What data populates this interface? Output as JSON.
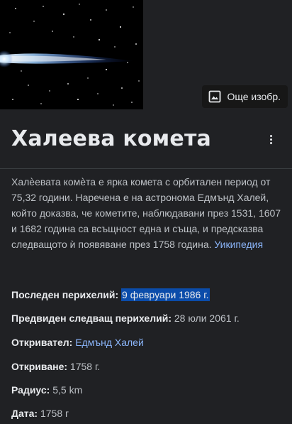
{
  "hero": {
    "more_images_label": "Още изобр."
  },
  "title": "Халеева комета",
  "description": {
    "text": "Халѐевата комѐта е ярка комета с орбитален период от 75,32 години. Наречена е на астронома Едмънд Халей, който доказва, че кометите, наблюдавани през 1531, 1607 и 1682 година са всъщност една и съща, и предсказва следващото ѝ появяване през 1758 година.",
    "source_link": "Уикипедия"
  },
  "facts": [
    {
      "label": "Последен перихелий:",
      "value": "9 февруари 1986 г.",
      "style": "highlight"
    },
    {
      "label": "Предвиден следващ перихелий:",
      "value": "28 юли 2061 г.",
      "style": "plain"
    },
    {
      "label": "Откривател:",
      "value": "Едмънд Халей",
      "style": "link"
    },
    {
      "label": "Откриване:",
      "value": "1758 г.",
      "style": "plain"
    },
    {
      "label": "Радиус:",
      "value": "5,5 km",
      "style": "plain"
    },
    {
      "label": "Дата:",
      "value": "1758 г",
      "style": "plain"
    }
  ],
  "colors": {
    "background": "#202124",
    "text": "#e8eaed",
    "secondary_text": "#bdc1c6",
    "link": "#8ab4f8",
    "selection": "#0b4caa"
  },
  "icons": {
    "more_images": "image-icon",
    "menu": "more-vert-icon"
  }
}
